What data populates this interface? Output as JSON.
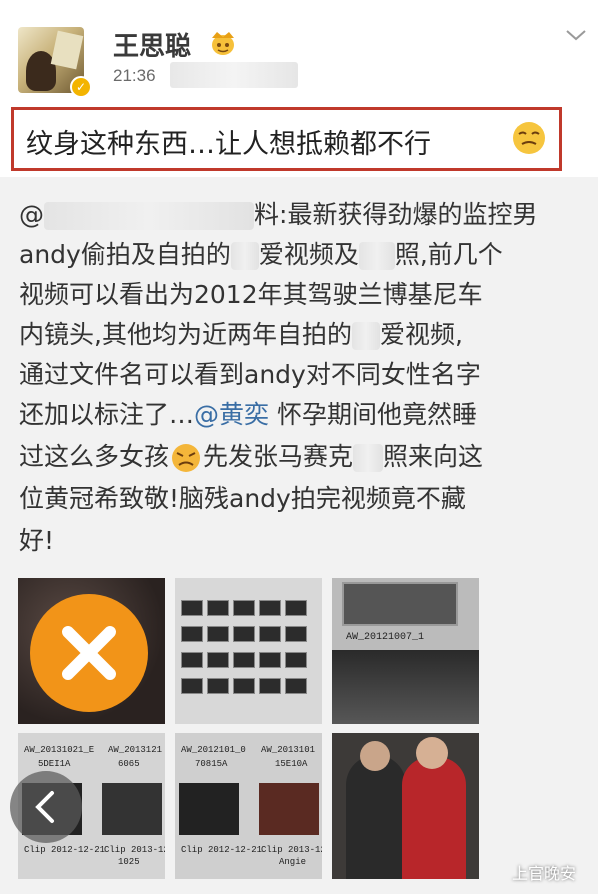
{
  "post": {
    "username": "王思聪",
    "time": "21:36",
    "quote": "纹身这种东西…让人想抵赖都不行",
    "lines": {
      "l1_prefix": "@",
      "l1_mid": "料",
      "l1_rest": ":最新获得劲爆的监控男",
      "l2_a": "andy偷拍及自拍的",
      "l2_b": "爱视频及",
      "l2_c": "照,前几个",
      "l3": "视频可以看出为2012年其驾驶兰博基尼车",
      "l4_a": "内镜头,其他均为近两年自拍的",
      "l4_b": "爱视频,",
      "l5": "通过文件名可以看到andy对不同女性名字",
      "l6_a": "还加以标注了…",
      "l6_mention": "@黄奕",
      "l6_b": " 怀孕期间他竟然睡",
      "l7_a": "过这么多女孩",
      "l7_b": "先发张马赛克",
      "l7_c": "照来向这",
      "l8": "位黄冠希致敬!脑残andy拍完视频竟不藏",
      "l9": "好!"
    }
  },
  "thumbnails": [
    {
      "id": "photo-1",
      "caption": ""
    },
    {
      "id": "photo-2",
      "caption": ""
    },
    {
      "id": "photo-3",
      "caption": "AW_20121007_1"
    },
    {
      "id": "photo-4",
      "captions": [
        "AW_20131021_E",
        "5DEI1A",
        "AW_2013121",
        "6065",
        "Clip 2012-12-21",
        "Clip 2013-12-23",
        "1025"
      ]
    },
    {
      "id": "photo-5",
      "captions": [
        "AW_2012101_0",
        "70815A",
        "AW_2013101",
        "15E10A",
        "Clip 2012-12-21",
        "Clip 2013-12-23",
        "Angie"
      ]
    },
    {
      "id": "photo-6",
      "caption": ""
    }
  ],
  "icons": {
    "remove": "x-icon",
    "back": "chevron-left-icon",
    "menu": "chevron-down-icon",
    "verified": "verified-badge-icon"
  },
  "colors": {
    "quote_border": "#c0392b",
    "mention": "#3a6ea5",
    "x_circle": "#f29418"
  },
  "watermark": "上官晚安"
}
